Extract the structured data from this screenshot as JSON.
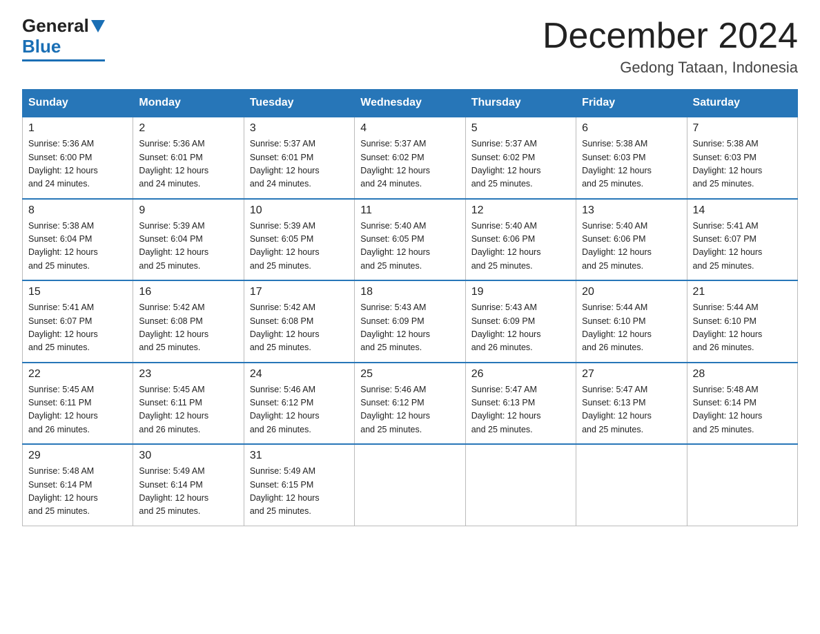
{
  "logo": {
    "general": "General",
    "blue": "Blue"
  },
  "header": {
    "month": "December 2024",
    "location": "Gedong Tataan, Indonesia"
  },
  "days_of_week": [
    "Sunday",
    "Monday",
    "Tuesday",
    "Wednesday",
    "Thursday",
    "Friday",
    "Saturday"
  ],
  "weeks": [
    [
      {
        "day": "1",
        "sunrise": "5:36 AM",
        "sunset": "6:00 PM",
        "daylight": "12 hours and 24 minutes."
      },
      {
        "day": "2",
        "sunrise": "5:36 AM",
        "sunset": "6:01 PM",
        "daylight": "12 hours and 24 minutes."
      },
      {
        "day": "3",
        "sunrise": "5:37 AM",
        "sunset": "6:01 PM",
        "daylight": "12 hours and 24 minutes."
      },
      {
        "day": "4",
        "sunrise": "5:37 AM",
        "sunset": "6:02 PM",
        "daylight": "12 hours and 24 minutes."
      },
      {
        "day": "5",
        "sunrise": "5:37 AM",
        "sunset": "6:02 PM",
        "daylight": "12 hours and 25 minutes."
      },
      {
        "day": "6",
        "sunrise": "5:38 AM",
        "sunset": "6:03 PM",
        "daylight": "12 hours and 25 minutes."
      },
      {
        "day": "7",
        "sunrise": "5:38 AM",
        "sunset": "6:03 PM",
        "daylight": "12 hours and 25 minutes."
      }
    ],
    [
      {
        "day": "8",
        "sunrise": "5:38 AM",
        "sunset": "6:04 PM",
        "daylight": "12 hours and 25 minutes."
      },
      {
        "day": "9",
        "sunrise": "5:39 AM",
        "sunset": "6:04 PM",
        "daylight": "12 hours and 25 minutes."
      },
      {
        "day": "10",
        "sunrise": "5:39 AM",
        "sunset": "6:05 PM",
        "daylight": "12 hours and 25 minutes."
      },
      {
        "day": "11",
        "sunrise": "5:40 AM",
        "sunset": "6:05 PM",
        "daylight": "12 hours and 25 minutes."
      },
      {
        "day": "12",
        "sunrise": "5:40 AM",
        "sunset": "6:06 PM",
        "daylight": "12 hours and 25 minutes."
      },
      {
        "day": "13",
        "sunrise": "5:40 AM",
        "sunset": "6:06 PM",
        "daylight": "12 hours and 25 minutes."
      },
      {
        "day": "14",
        "sunrise": "5:41 AM",
        "sunset": "6:07 PM",
        "daylight": "12 hours and 25 minutes."
      }
    ],
    [
      {
        "day": "15",
        "sunrise": "5:41 AM",
        "sunset": "6:07 PM",
        "daylight": "12 hours and 25 minutes."
      },
      {
        "day": "16",
        "sunrise": "5:42 AM",
        "sunset": "6:08 PM",
        "daylight": "12 hours and 25 minutes."
      },
      {
        "day": "17",
        "sunrise": "5:42 AM",
        "sunset": "6:08 PM",
        "daylight": "12 hours and 25 minutes."
      },
      {
        "day": "18",
        "sunrise": "5:43 AM",
        "sunset": "6:09 PM",
        "daylight": "12 hours and 25 minutes."
      },
      {
        "day": "19",
        "sunrise": "5:43 AM",
        "sunset": "6:09 PM",
        "daylight": "12 hours and 26 minutes."
      },
      {
        "day": "20",
        "sunrise": "5:44 AM",
        "sunset": "6:10 PM",
        "daylight": "12 hours and 26 minutes."
      },
      {
        "day": "21",
        "sunrise": "5:44 AM",
        "sunset": "6:10 PM",
        "daylight": "12 hours and 26 minutes."
      }
    ],
    [
      {
        "day": "22",
        "sunrise": "5:45 AM",
        "sunset": "6:11 PM",
        "daylight": "12 hours and 26 minutes."
      },
      {
        "day": "23",
        "sunrise": "5:45 AM",
        "sunset": "6:11 PM",
        "daylight": "12 hours and 26 minutes."
      },
      {
        "day": "24",
        "sunrise": "5:46 AM",
        "sunset": "6:12 PM",
        "daylight": "12 hours and 26 minutes."
      },
      {
        "day": "25",
        "sunrise": "5:46 AM",
        "sunset": "6:12 PM",
        "daylight": "12 hours and 25 minutes."
      },
      {
        "day": "26",
        "sunrise": "5:47 AM",
        "sunset": "6:13 PM",
        "daylight": "12 hours and 25 minutes."
      },
      {
        "day": "27",
        "sunrise": "5:47 AM",
        "sunset": "6:13 PM",
        "daylight": "12 hours and 25 minutes."
      },
      {
        "day": "28",
        "sunrise": "5:48 AM",
        "sunset": "6:14 PM",
        "daylight": "12 hours and 25 minutes."
      }
    ],
    [
      {
        "day": "29",
        "sunrise": "5:48 AM",
        "sunset": "6:14 PM",
        "daylight": "12 hours and 25 minutes."
      },
      {
        "day": "30",
        "sunrise": "5:49 AM",
        "sunset": "6:14 PM",
        "daylight": "12 hours and 25 minutes."
      },
      {
        "day": "31",
        "sunrise": "5:49 AM",
        "sunset": "6:15 PM",
        "daylight": "12 hours and 25 minutes."
      },
      null,
      null,
      null,
      null
    ]
  ],
  "labels": {
    "sunrise": "Sunrise:",
    "sunset": "Sunset:",
    "daylight": "Daylight:"
  }
}
